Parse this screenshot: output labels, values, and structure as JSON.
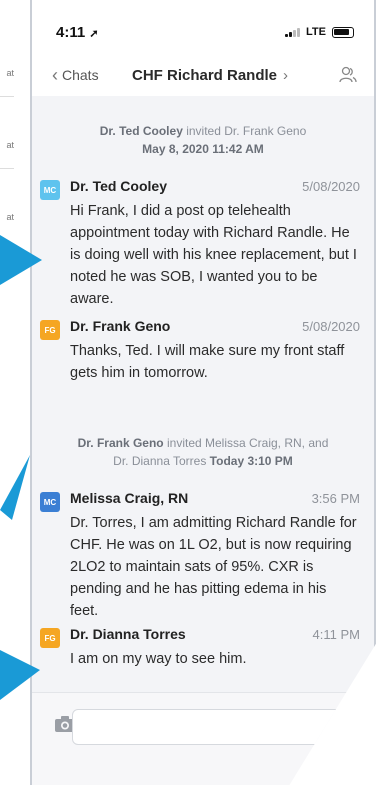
{
  "background": {
    "row_texts": [
      "at",
      "at",
      "at"
    ]
  },
  "status_bar": {
    "time": "4:11",
    "network": "LTE"
  },
  "nav": {
    "back_label": "Chats",
    "title": "CHF Richard Randle",
    "title_chevron": "›"
  },
  "system_messages": [
    {
      "actor": "Dr. Ted Cooley",
      "text": " invited Dr. Frank Geno",
      "date": "May 8, 2020 11:42 AM"
    },
    {
      "actor": "Dr. Frank Geno",
      "text": " invited Melissa Craig, RN, and",
      "line2": "Dr. Dianna Torres ",
      "date": "Today 3:10 PM"
    }
  ],
  "messages": [
    {
      "initials": "MC",
      "color": "#5ec3ee",
      "sender": "Dr. Ted Cooley",
      "time": "5/08/2020",
      "text": "Hi Frank, I did a post op telehealth appointment today with Richard Randle. He is doing well with his knee replacement, but I noted he was SOB, I wanted you to be aware."
    },
    {
      "initials": "FG",
      "color": "#f5a623",
      "sender": "Dr. Frank Geno",
      "time": "5/08/2020",
      "text": "Thanks, Ted. I will make sure my front staff gets him in tomorrow."
    },
    {
      "initials": "MC",
      "color": "#3b7fd4",
      "sender": "Melissa Craig, RN",
      "time": "3:56 PM",
      "text": "Dr. Torres, I am admitting Richard Randle for CHF. He was on 1L O2, but is now requiring 2LO2 to maintain sats of 95%. CXR is pending and he has pitting edema in his feet."
    },
    {
      "initials": "FG",
      "color": "#f5a623",
      "sender": "Dr. Dianna Torres",
      "time": "4:11 PM",
      "text": "I am on my way to see him."
    }
  ],
  "icons": {
    "back": "chevron-left-icon",
    "user": "user-group-icon",
    "camera": "camera-icon",
    "location": "location-arrow-icon"
  },
  "colors": {
    "accent_arrow": "#1a9ad6",
    "chat_bg": "#f3f4f7"
  }
}
